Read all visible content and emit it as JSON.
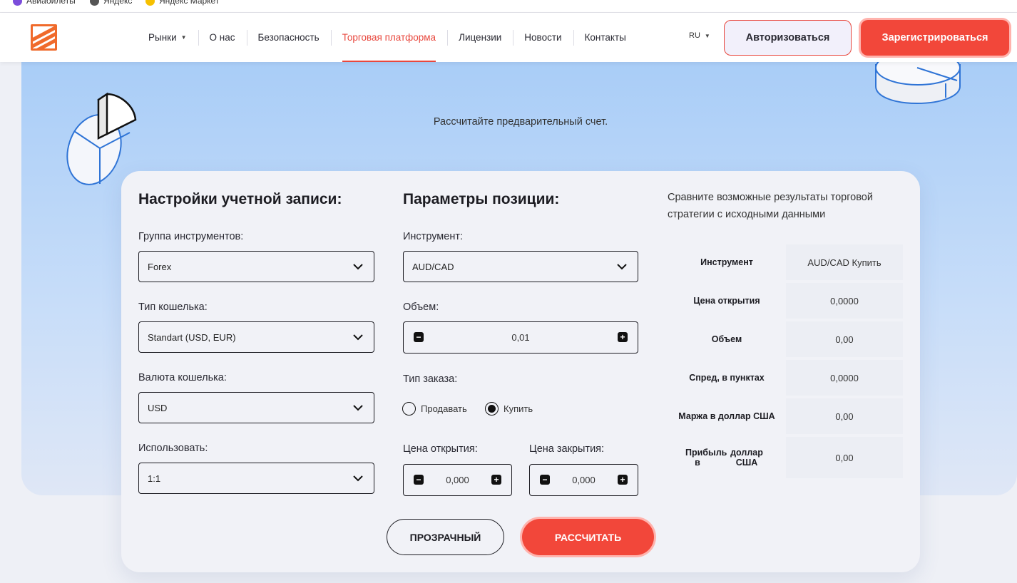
{
  "bookmarks": [
    {
      "label": "Авиабилеты",
      "color": "#7b4ddb"
    },
    {
      "label": "Яндекс",
      "color": "#555555"
    },
    {
      "label": "Яндекс Маркет",
      "color": "#f6c000"
    }
  ],
  "nav": {
    "items": [
      {
        "label": "Рынки",
        "has_caret": true
      },
      {
        "label": "О нас"
      },
      {
        "label": "Безопасность"
      },
      {
        "label": "Торговая платформа",
        "active": true
      },
      {
        "label": "Лицензии"
      },
      {
        "label": "Новости"
      },
      {
        "label": "Контакты"
      }
    ],
    "lang": "RU",
    "login": "Авторизоваться",
    "register": "Зарегистрироваться"
  },
  "hero": {
    "subtitle": "Рассчитайте предварительный счет."
  },
  "account": {
    "title": "Настройки учетной записи:",
    "instrument_group": {
      "label": "Группа инструментов:",
      "value": "Forex"
    },
    "wallet_type": {
      "label": "Тип кошелька:",
      "value": "Standart (USD, EUR)"
    },
    "wallet_currency": {
      "label": "Валюта кошелька:",
      "value": "USD"
    },
    "leverage": {
      "label": "Использовать:",
      "value": "1:1"
    }
  },
  "position": {
    "title": "Параметры позиции:",
    "instrument": {
      "label": "Инструмент:",
      "value": "AUD/CAD"
    },
    "volume": {
      "label": "Объем:",
      "value": "0,01"
    },
    "order_type": {
      "label": "Тип заказа:",
      "sell": "Продавать",
      "buy": "Купить",
      "selected": "buy"
    },
    "open_price": {
      "label": "Цена открытия:",
      "value": "0,000"
    },
    "close_price": {
      "label": "Цена закрытия:",
      "value": "0,000"
    }
  },
  "results": {
    "intro": "Сравните возможные результаты торговой стратегии с исходными данными",
    "rows": [
      {
        "key": "Инструмент",
        "value": "AUD/CAD Купить"
      },
      {
        "key": "Цена открытия",
        "value": "0,0000"
      },
      {
        "key": "Объем",
        "value": "0,00"
      },
      {
        "key": "Спред, в пунктах",
        "value": "0,0000"
      },
      {
        "key": "Маржа в доллар США",
        "value": "0,00"
      }
    ],
    "profit": {
      "key_a": "Прибыль в",
      "key_b": "доллар США",
      "value": "0,00"
    }
  },
  "actions": {
    "clear": "ПРОЗРАЧНЫЙ",
    "calculate": "РАССЧИТАТЬ"
  }
}
